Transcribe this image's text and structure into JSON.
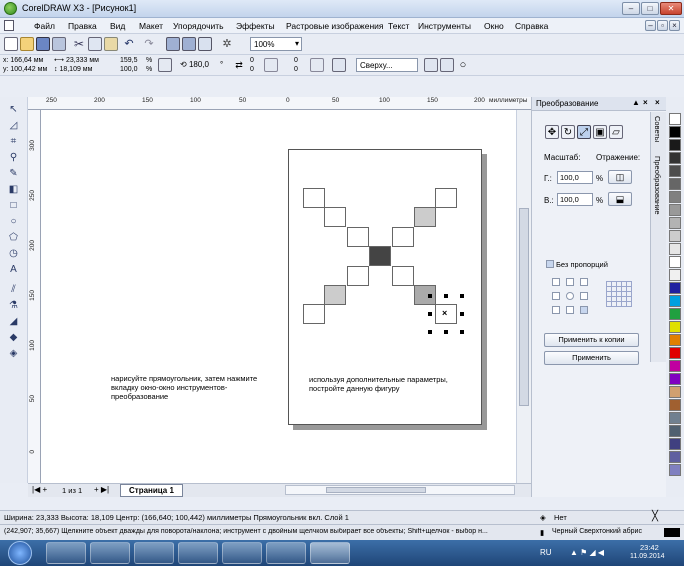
{
  "window": {
    "title": "CorelDRAW X3 - [Рисунок1]"
  },
  "menu": [
    "Файл",
    "Правка",
    "Вид",
    "Макет",
    "Упорядочить",
    "Эффекты",
    "Растровые изображения",
    "Текст",
    "Инструменты",
    "Окно",
    "Справка"
  ],
  "toolbar": {
    "zoom": "100%"
  },
  "property_bar": {
    "x": "x: 166,64 мм",
    "y": "y: 100,442 мм",
    "width": "23,333 мм",
    "height": "18,109 мм",
    "scale_x": "159,5",
    "scale_y": "100,0",
    "percent": "%",
    "rotation": "180,0",
    "degree": "°",
    "n1": "0",
    "n2": "0",
    "n3": "0",
    "n4": "0",
    "wrap": "Сверху..."
  },
  "ruler": {
    "h_labels": [
      "250",
      "200",
      "150",
      "100",
      "50",
      "0",
      "50",
      "100",
      "150",
      "200",
      "миллиметры"
    ],
    "v_labels": [
      "300",
      "250",
      "200",
      "150",
      "100",
      "50",
      "0"
    ]
  },
  "canvas": {
    "note1": "нарисуйте прямоугольник, затем нажмите вкладку окно-окно инструментов-преобразование",
    "note2": "используя дополнительные параметры, постройте данную фигуру",
    "selected_marker": "×"
  },
  "page_tabs": {
    "counter": "1 из 1",
    "page": "Страница 1"
  },
  "docker": {
    "title": "Преобразование",
    "scale_label": "Масштаб:",
    "mirror_label": "Отражение:",
    "h_label": "Г.:",
    "v_label": "В.:",
    "h_value": "100,0",
    "v_value": "100,0",
    "percent": "%",
    "proportional": "Без пропорций",
    "apply_copy": "Применить к копии",
    "apply": "Применить",
    "tab_hints": "Советы",
    "tab_transform": "Преобразование"
  },
  "status": {
    "line1": "Ширина: 23,333 Высота: 18,109 Центр: (166,640; 100,442) миллиметры    Прямоугольник вкл. Слой 1",
    "line2": "(242,907; 35,667)    Щелкните объект дважды для поворота/наклона; инструмент с двойным щелчком выбирает все объекты; Shift+щелчок - выбор н...",
    "fill": "Нет",
    "outline": "Черный  Сверхтонкий абрис"
  },
  "taskbar": {
    "lang": "RU",
    "time": "23:42",
    "date": "11.09.2014"
  },
  "colors": {
    "accent": "#3c6fa8",
    "palette": [
      "#ffffff",
      "#000000",
      "#1a1a1a",
      "#333333",
      "#4d4d4d",
      "#666666",
      "#808080",
      "#999999",
      "#b3b3b3",
      "#cccccc",
      "#e6e6e6",
      "#ffffff",
      "#f0f0f0",
      "#2020a0",
      "#00a0e0",
      "#20a040",
      "#e0e000",
      "#e08000",
      "#e00000",
      "#c000a0",
      "#8000c0",
      "#d0a070",
      "#a06030",
      "#708090",
      "#506070",
      "#404080",
      "#6060a0",
      "#8080c0"
    ]
  }
}
